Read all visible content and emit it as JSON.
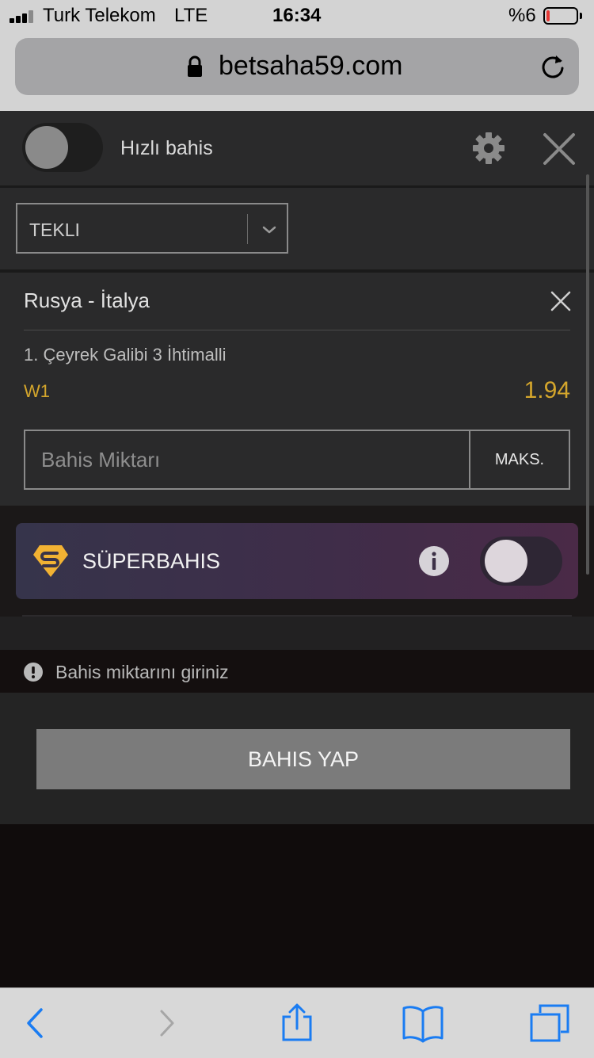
{
  "status_bar": {
    "carrier": "Turk Telekom",
    "network": "LTE",
    "time": "16:34",
    "battery": "%6",
    "battery_level_percent": 6
  },
  "browser": {
    "url": "betsaha59.com"
  },
  "betslip": {
    "quick_bet_label": "Hızlı bahis",
    "quick_bet_enabled": false,
    "bet_type": "TEKLI",
    "event": {
      "title": "Rusya - İtalya",
      "market": "1. Çeyrek Galibi 3 İhtimalli",
      "selection": "W1",
      "odds": "1.94"
    },
    "stake_placeholder": "Bahis Miktarı",
    "max_label": "MAKS.",
    "super_bet_label": "SÜPERBAHIS",
    "super_bet_enabled": false,
    "message": "Bahis miktarını giriniz",
    "place_bet_label": "BAHIS YAP"
  },
  "colors": {
    "accent_gold": "#d4a62c",
    "ios_blue": "#1a7cf2",
    "panel_bg": "#2a2a2b",
    "super_logo": "#f2b233"
  },
  "icons": {
    "settings": "gear-icon",
    "close": "close-icon",
    "remove_selection": "remove-icon",
    "dropdown": "chevron-down-icon",
    "info": "info-icon",
    "alert": "alert-icon",
    "super_logo": "super-logo-icon",
    "back": "back-icon",
    "forward": "forward-icon",
    "share": "share-icon",
    "bookmarks": "bookmarks-icon",
    "tabs": "tabs-icon",
    "lock": "lock-icon",
    "reload": "reload-icon"
  }
}
